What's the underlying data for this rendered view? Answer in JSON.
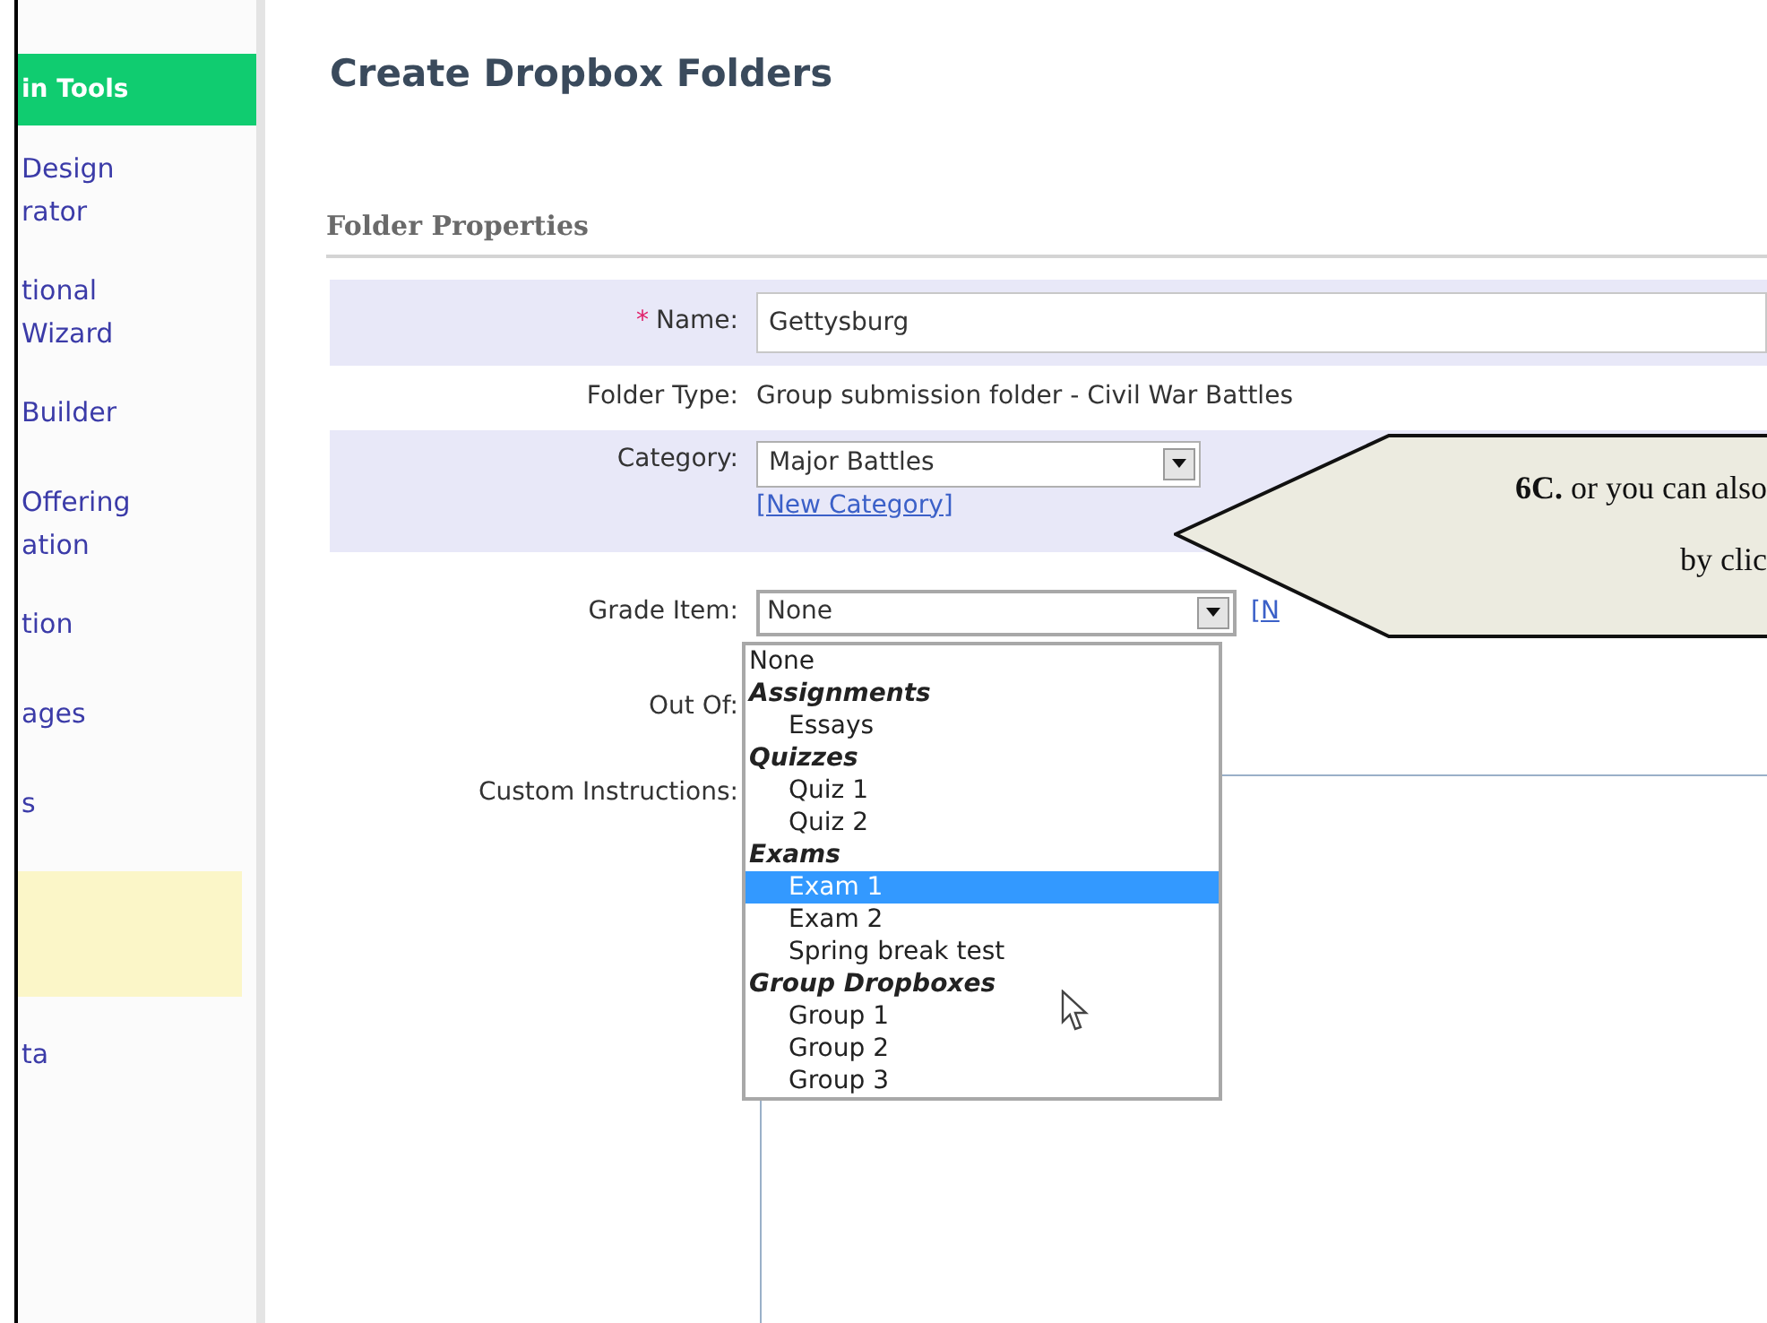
{
  "sidebar": {
    "title": "in Tools",
    "items": [
      {
        "lines": [
          "Design",
          "rator"
        ],
        "selected": false
      },
      {
        "lines": [
          "tional",
          "Wizard"
        ],
        "selected": false
      },
      {
        "lines": [
          "Builder"
        ],
        "selected": false
      },
      {
        "lines": [
          "Offering",
          "ation"
        ],
        "selected": false
      },
      {
        "lines": [
          "tion"
        ],
        "selected": false
      },
      {
        "lines": [
          "ages"
        ],
        "selected": false
      },
      {
        "lines": [
          "s"
        ],
        "selected": false
      },
      {
        "selected": true
      },
      {
        "lines": [
          "ta"
        ],
        "selected": false
      }
    ]
  },
  "page_title": "Create Dropbox Folders",
  "section_title": "Folder Properties",
  "form": {
    "name": {
      "label": "Name:",
      "required": true,
      "required_mark": "*",
      "value": "Gettysburg"
    },
    "folder_type": {
      "label": "Folder Type:",
      "value": "Group submission folder - Civil War Battles"
    },
    "category": {
      "label": "Category:",
      "value": "Major Battles",
      "link": "[New Category]"
    },
    "grade_item": {
      "label": "Grade Item:",
      "value": "None",
      "link": "[N"
    },
    "out_of": {
      "label": "Out Of:"
    },
    "custom_instructions": {
      "label": "Custom Instructions:"
    }
  },
  "dropdown_options": [
    {
      "kind": "option",
      "label": "None",
      "selected": false
    },
    {
      "kind": "group",
      "label": "Assignments"
    },
    {
      "kind": "suboption",
      "label": "Essays",
      "selected": false
    },
    {
      "kind": "group",
      "label": "Quizzes"
    },
    {
      "kind": "suboption",
      "label": "Quiz 1",
      "selected": false
    },
    {
      "kind": "suboption",
      "label": "Quiz 2",
      "selected": false
    },
    {
      "kind": "group",
      "label": "Exams"
    },
    {
      "kind": "suboption",
      "label": "Exam 1",
      "selected": true
    },
    {
      "kind": "suboption",
      "label": "Exam 2",
      "selected": false
    },
    {
      "kind": "suboption",
      "label": "Spring break test",
      "selected": false
    },
    {
      "kind": "group",
      "label": "Group Dropboxes"
    },
    {
      "kind": "suboption",
      "label": "Group 1",
      "selected": false
    },
    {
      "kind": "suboption",
      "label": "Group 2",
      "selected": false
    },
    {
      "kind": "suboption",
      "label": "Group 3",
      "selected": false
    }
  ],
  "callout": {
    "lines": [
      "**6C.** or you can also",
      "by clic"
    ]
  }
}
